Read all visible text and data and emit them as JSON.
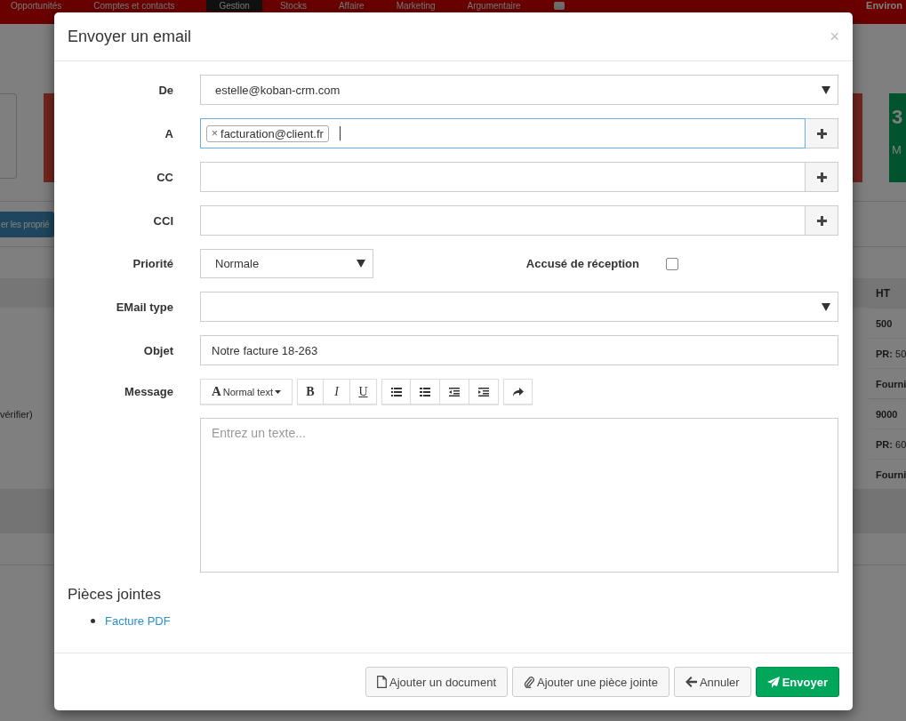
{
  "nav": {
    "items": [
      {
        "label": "Opportunités",
        "selected": false
      },
      {
        "label": "Comptes et contacts",
        "selected": false
      },
      {
        "label": "Gestion",
        "selected": true
      },
      {
        "label": "Stocks",
        "selected": false
      },
      {
        "label": "Affaire",
        "selected": false
      },
      {
        "label": "Marketing",
        "selected": false
      },
      {
        "label": "Argumentaire",
        "selected": false
      }
    ],
    "brand": "Environ"
  },
  "background": {
    "left_button": "er les proprié",
    "stat": {
      "value": "3",
      "label": "M"
    },
    "table_header": "HT",
    "rows": [
      {
        "kind": "amount",
        "text": "500"
      },
      {
        "kind": "cost",
        "text": "**PR:** 50"
      },
      {
        "kind": "supplier",
        "text": "Fourni"
      },
      {
        "kind": "amount",
        "text": "9000",
        "left_text": "vérifier)"
      },
      {
        "kind": "cost",
        "text": "**PR:** 60"
      },
      {
        "kind": "supplier",
        "text": "Fourni"
      }
    ]
  },
  "modal": {
    "title": "Envoyer un email",
    "close": "×",
    "fields": [
      {
        "kind": "select",
        "label": "De",
        "value": "estelle@koban-crm.com"
      },
      {
        "kind": "tags",
        "label": "A",
        "tags": [
          "facturation@client.fr"
        ],
        "tag_remove": "×",
        "focused": true
      },
      {
        "kind": "add",
        "label": "CC",
        "focused": false
      },
      {
        "kind": "add",
        "label": "CCI",
        "focused": false
      },
      {
        "kind": "priority",
        "label": "Priorité",
        "value": "Normale",
        "receipt_label": "Accusé de réception",
        "receipt_checked": false
      },
      {
        "kind": "select",
        "label": "EMail type"
      },
      {
        "kind": "text",
        "label": "Objet",
        "value": "Notre facture 18-263"
      },
      {
        "kind": "editor",
        "label": "Message",
        "format_icon": "A",
        "format_label": "Normal text",
        "styles": [
          "B",
          "I",
          "U"
        ],
        "placeholder": "Entrez un texte..."
      }
    ],
    "attachments": {
      "title": "Pièces jointes",
      "items": [
        "Facture PDF"
      ]
    },
    "buttons": [
      {
        "kind": "document",
        "label": "Ajouter un document",
        "primary": false
      },
      {
        "kind": "attach",
        "label": "Ajouter une pièce jointe",
        "primary": false
      },
      {
        "kind": "back",
        "label": "Annuler",
        "primary": false
      },
      {
        "kind": "send",
        "label": "Envoyer",
        "primary": true
      }
    ]
  }
}
